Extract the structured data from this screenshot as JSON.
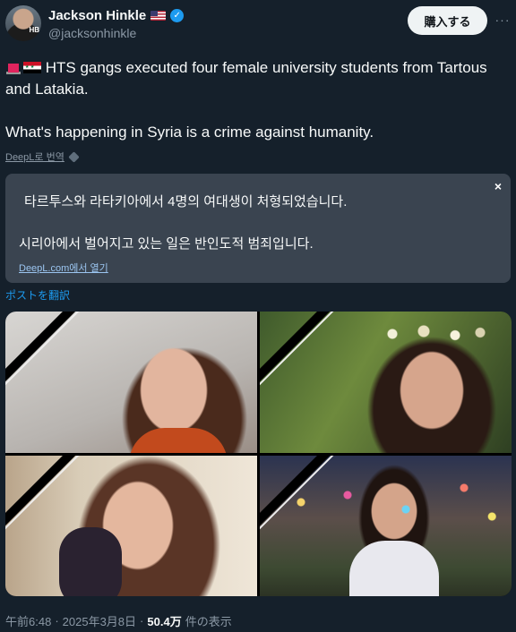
{
  "author": {
    "display_name": "Jackson Hinkle",
    "handle": "@jacksonhinkle",
    "avatar_badge": "HB",
    "flag_icon": "us-flag-icon",
    "verified_icon": "verified-badge-icon"
  },
  "header": {
    "buy_label": "購入する",
    "more_label": "···"
  },
  "tweet": {
    "line1": "HTS gangs executed four female university students from Tartous and Latakia.",
    "line2": "What's happening in Syria is a crime against humanity."
  },
  "deepl": {
    "translate_label": "DeepL로 번역"
  },
  "translation": {
    "close_label": "×",
    "line1": "타르투스와 라타키아에서 4명의 여대생이 처형되었습니다.",
    "line2": "시리아에서 벌어지고 있는 일은 반인도적 범죄입니다.",
    "link_label": "DeepL.com에서 열기"
  },
  "translate_post_label": "ポストを翻訳",
  "footer": {
    "time": "午前6:48",
    "sep1": "·",
    "date": "2025年3月8日",
    "sep2": "·",
    "views_count": "50.4万",
    "views_label": "件の表示"
  },
  "colors": {
    "background": "#15202b",
    "accent": "#1d9bf0",
    "translation_box": "#3a4450"
  }
}
